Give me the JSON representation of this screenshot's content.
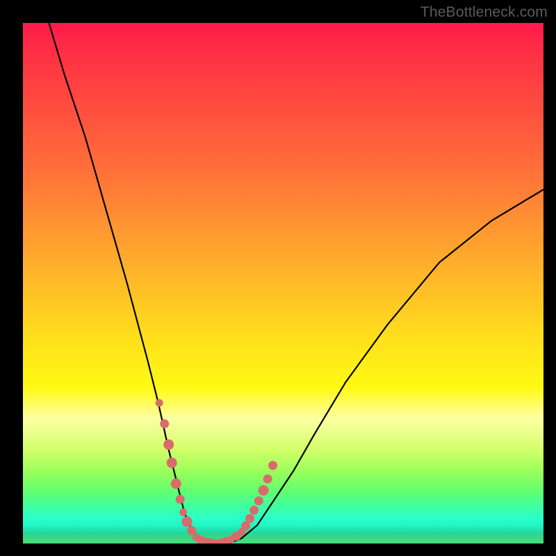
{
  "watermark": "TheBottleneck.com",
  "colors": {
    "curve_stroke": "#000000",
    "dot_fill": "#d96b6b",
    "dot_stroke": "#d96b6b"
  },
  "chart_data": {
    "type": "line",
    "title": "",
    "xlabel": "",
    "ylabel": "",
    "xlim": [
      0,
      100
    ],
    "ylim": [
      0,
      100
    ],
    "series": [
      {
        "name": "curve",
        "x": [
          5,
          8,
          12,
          16,
          20,
          24,
          26,
          28,
          30,
          31,
          32,
          33,
          34,
          35,
          36,
          37,
          38,
          40,
          42,
          45,
          48,
          52,
          56,
          62,
          70,
          80,
          90,
          100
        ],
        "y": [
          100,
          90,
          78,
          64,
          50,
          35,
          27,
          18,
          10,
          6,
          3.5,
          1.8,
          0.8,
          0.3,
          0,
          0,
          0,
          0.2,
          1,
          3.5,
          8,
          14,
          21,
          31,
          42,
          54,
          62,
          68
        ]
      }
    ],
    "dots": {
      "name": "observations",
      "x": [
        26.2,
        27.2,
        28.0,
        28.6,
        29.4,
        30.2,
        30.8,
        31.5,
        32.4,
        33.3,
        34.2,
        35.0,
        35.6,
        36.2,
        37.0,
        38.0,
        39.0,
        40.0,
        41.0,
        42.0,
        42.8,
        43.6,
        44.4,
        45.3,
        46.2,
        47.0,
        48.0
      ],
      "y": [
        27.0,
        23.0,
        19.0,
        15.5,
        11.5,
        8.5,
        6.0,
        4.2,
        2.5,
        1.2,
        0.6,
        0.3,
        0.15,
        0.1,
        0.1,
        0.2,
        0.4,
        0.8,
        1.4,
        2.2,
        3.4,
        4.8,
        6.4,
        8.2,
        10.2,
        12.4,
        15.0
      ],
      "r": [
        5,
        6,
        7,
        7,
        7,
        6,
        5,
        7,
        6,
        5,
        6,
        6,
        6,
        6,
        5,
        5,
        6,
        5,
        6,
        5,
        6,
        6,
        6,
        6,
        7,
        6,
        6
      ]
    }
  }
}
